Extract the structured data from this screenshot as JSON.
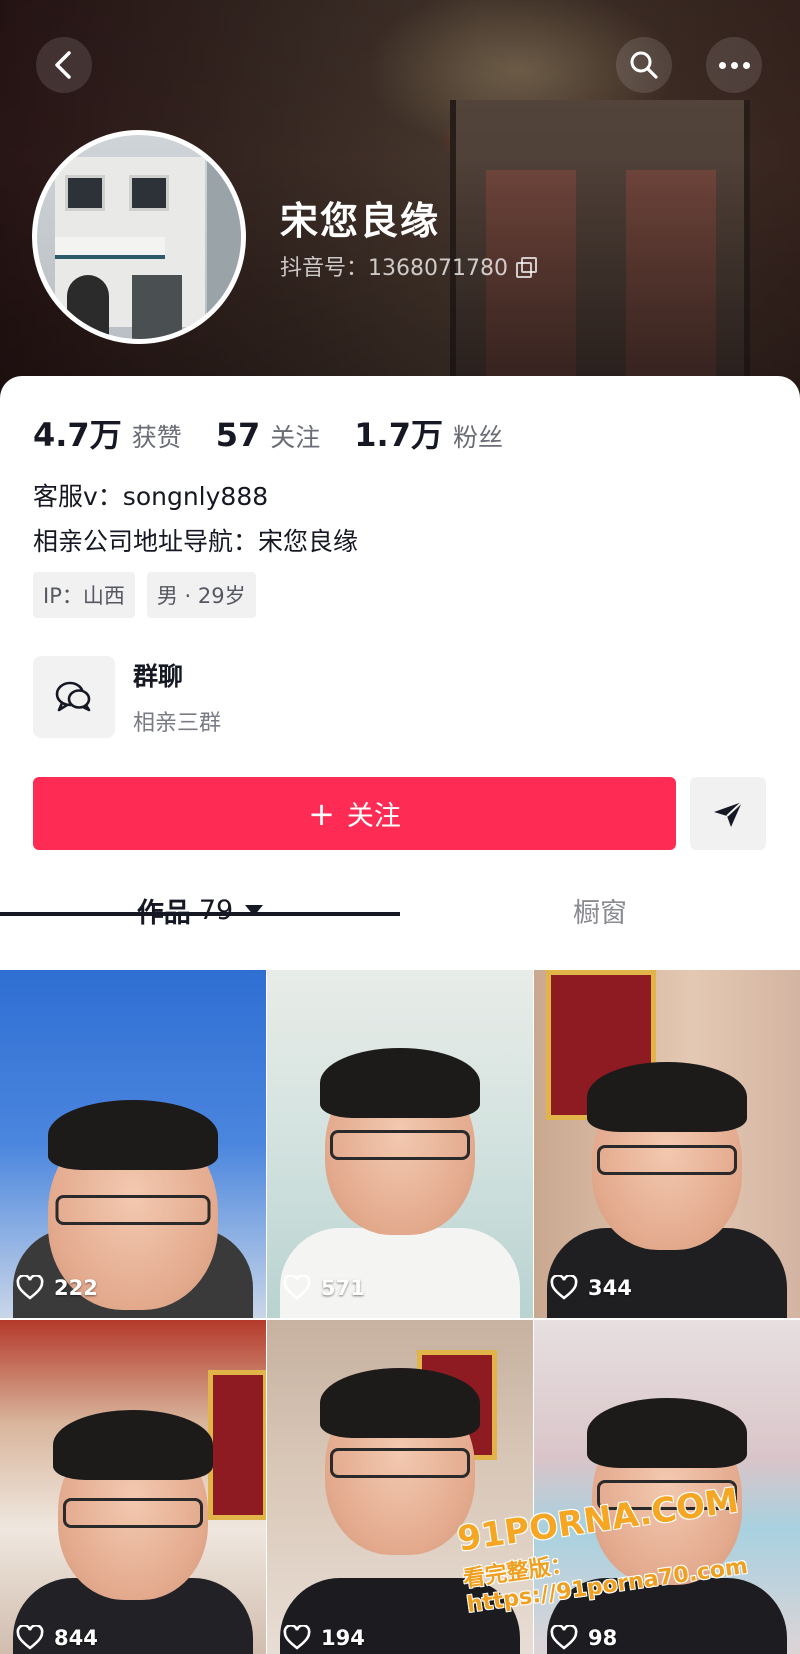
{
  "header": {
    "profile_name": "宋您良缘",
    "douyin_id": "抖音号：1368071780",
    "icons": {
      "back": "back-arrow-icon",
      "search": "search-icon",
      "more": "more-dots-icon",
      "copy": "copy-icon"
    }
  },
  "stats": [
    {
      "value": "4.7万",
      "label": "获赞"
    },
    {
      "value": "57",
      "label": "关注"
    },
    {
      "value": "1.7万",
      "label": "粉丝"
    }
  ],
  "bio": {
    "line1": "客服v：songnly888",
    "line2": "相亲公司地址导航：宋您良缘"
  },
  "tags": {
    "ip": "IP：山西",
    "gender_age": "男 · 29岁"
  },
  "group_chat": {
    "title": "群聊",
    "subtitle": "相亲三群",
    "icon": "chat-bubbles-icon"
  },
  "actions": {
    "follow_plus": "+",
    "follow_label": "关注",
    "share_icon": "send-arrow-icon"
  },
  "tabs": {
    "works_label": "作品",
    "works_count": "79",
    "showcase_label": "橱窗"
  },
  "videos": [
    {
      "likes": "222"
    },
    {
      "likes": "571"
    },
    {
      "likes": "344"
    },
    {
      "likes": "844"
    },
    {
      "likes": "194"
    },
    {
      "likes": "98"
    }
  ],
  "watermark": {
    "line1": "91PORNA.COM",
    "line2": "看完整版：https://91porna70.com"
  },
  "colors": {
    "accent": "#fe2c55",
    "text_primary": "#161823",
    "text_secondary": "#6b6d76",
    "tag_bg": "#f1f1f2"
  }
}
